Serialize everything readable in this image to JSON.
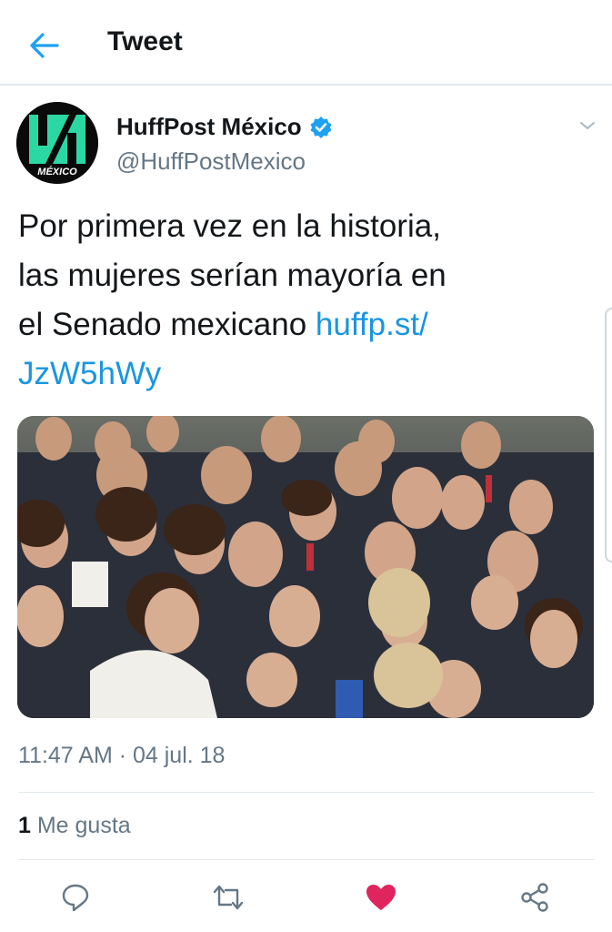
{
  "header": {
    "title": "Tweet",
    "back_icon": "arrow-left-icon"
  },
  "author": {
    "display_name": "HuffPost México",
    "handle": "@HuffPostMexico",
    "verified": true,
    "avatar_label": "MÉXICO",
    "accent": "#2bd8a4"
  },
  "tweet": {
    "text_lines": [
      "Por primera vez en la historia,",
      "las mujeres serían mayoría en",
      "el Senado mexicano "
    ],
    "link_part1": "huffp.st/",
    "link_part2": "JzW5hWy",
    "timestamp": "11:47 AM · 04 jul. 18"
  },
  "stats": {
    "likes_count": "1",
    "likes_label": " Me gusta"
  },
  "actions": [
    {
      "name": "reply",
      "icon": "reply-icon"
    },
    {
      "name": "retweet",
      "icon": "retweet-icon"
    },
    {
      "name": "like",
      "icon": "heart-icon",
      "active": true
    },
    {
      "name": "share",
      "icon": "share-icon"
    }
  ],
  "colors": {
    "link": "#1b95e0",
    "secondary_text": "#657786",
    "like_active": "#e0245e",
    "divider": "#e1e8ed"
  }
}
